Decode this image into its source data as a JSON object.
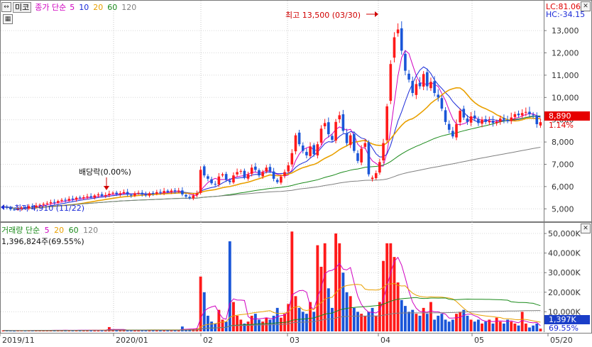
{
  "price_header": {
    "scroll_icon": "left-right-arrow-icon",
    "name_label": "미코",
    "ma_prefix": "종가 단순",
    "ma_periods": [
      {
        "label": "5",
        "color": "#d000c0"
      },
      {
        "label": "10",
        "color": "#1a2ad8"
      },
      {
        "label": "20",
        "color": "#e9a000"
      },
      {
        "label": "60",
        "color": "#1a8a1a"
      },
      {
        "label": "120",
        "color": "#808080"
      }
    ],
    "grid_icon": "table-grid-icon"
  },
  "volume_header": {
    "ma_prefix": "거래량 단순",
    "ma_periods": [
      {
        "label": "5",
        "color": "#d000c0"
      },
      {
        "label": "20",
        "color": "#e9a000"
      },
      {
        "label": "60",
        "color": "#1a8a1a"
      },
      {
        "label": "120",
        "color": "#808080"
      }
    ],
    "current_volume": "1,396,824주(69.55%)"
  },
  "readouts": {
    "lc": "LC:81.06",
    "hc": "HC:-34.15",
    "price_tag": "8,890",
    "change_tag": "1.14%",
    "volume_tag": "1,397K",
    "volume_pct_tag": "69.55%"
  },
  "annotations": {
    "high": "최고 13,500 (03/30)",
    "low": "최저 4,910 (11/22)",
    "dividend": "배당락(0.00%)"
  },
  "close_icon": "close-x-icon",
  "chart_data": [
    {
      "type": "candlestick",
      "title": "미코",
      "y_ticks": [
        "13,000",
        "12,000",
        "11,000",
        "10,000",
        "9,000",
        "8,000",
        "7,000",
        "6,000",
        "5,000"
      ],
      "x_ticks": [
        "2019/11",
        "2020/01",
        "02",
        "03",
        "04",
        "05",
        "05/20"
      ],
      "ylim": [
        4500,
        13800
      ],
      "up_color": "#ff1a1a",
      "down_color": "#1a56d8",
      "last_price": 8890,
      "high": 13500,
      "low": 4910,
      "series": [
        {
          "name": "5",
          "color": "#d000c0"
        },
        {
          "name": "10",
          "color": "#1a2ad8"
        },
        {
          "name": "20",
          "color": "#e9a000"
        },
        {
          "name": "60",
          "color": "#1a8a1a"
        },
        {
          "name": "120",
          "color": "#808080"
        }
      ],
      "closes": [
        5100,
        5050,
        4980,
        4950,
        5000,
        5060,
        5020,
        5120,
        5080,
        5150,
        5180,
        5220,
        5250,
        5300,
        5280,
        5350,
        5400,
        5380,
        5450,
        5420,
        5500,
        5480,
        5520,
        5560,
        5510,
        5600,
        5650,
        5580,
        5620,
        5680,
        5720,
        5660,
        5700,
        5750,
        5640,
        5600,
        5700,
        5720,
        5650,
        5600,
        5700,
        5680,
        5750,
        5720,
        5800,
        5760,
        5820,
        5780,
        5820,
        5650,
        5550,
        5480,
        5600,
        5700,
        6750,
        6500,
        6350,
        6150,
        6100,
        6450,
        6550,
        6300,
        6200,
        6500,
        6650,
        6700,
        6400,
        6550,
        6850,
        6750,
        6500,
        6650,
        6850,
        6700,
        6350,
        6200,
        6450,
        6650,
        6950,
        7500,
        8300,
        7900,
        7600,
        7400,
        7800,
        7450,
        7900,
        8600,
        8850,
        8350,
        8100,
        8900,
        9200,
        8500,
        7950,
        8300,
        7600,
        7150,
        7700,
        7950,
        6550,
        6400,
        6600,
        7100,
        7950,
        9600,
        11500,
        12700,
        13050,
        12100,
        11200,
        10800,
        10200,
        10600,
        10500,
        11050,
        10500,
        10700,
        10200,
        10000,
        9500,
        8900,
        8550,
        8250,
        8800,
        9400,
        9100,
        8900,
        9150,
        9050,
        8850,
        9000,
        8900,
        8950,
        8850,
        8900,
        9050,
        9000,
        8950,
        9100,
        9250,
        9200,
        9300,
        9350,
        9250,
        9200,
        8800,
        8890
      ],
      "volume": {
        "type": "bar",
        "y_ticks": [
          "50,000K",
          "40,000K",
          "30,000K",
          "20,000K",
          "10,000K"
        ],
        "ylim": [
          0,
          54000
        ],
        "values": [
          500,
          400,
          350,
          300,
          380,
          420,
          350,
          500,
          450,
          520,
          600,
          550,
          480,
          650,
          700,
          600,
          550,
          500,
          620,
          580,
          700,
          650,
          600,
          550,
          700,
          750,
          680,
          600,
          650,
          2200,
          700,
          750,
          650,
          600,
          700,
          680,
          720,
          650,
          700,
          600,
          800,
          750,
          700,
          650,
          720,
          680,
          700,
          650,
          600,
          2500,
          900,
          1100,
          1200,
          1500,
          28000,
          20000,
          8000,
          5000,
          4000,
          11000,
          6000,
          5000,
          46000,
          15000,
          8000,
          6000,
          4000,
          5000,
          8000,
          9000,
          6000,
          5000,
          7000,
          6000,
          8000,
          12000,
          7000,
          9000,
          14000,
          51000,
          18000,
          12000,
          10000,
          9000,
          15000,
          10000,
          44000,
          33000,
          45000,
          22000,
          12000,
          50000,
          45000,
          30000,
          20000,
          18000,
          12000,
          10000,
          9000,
          8000,
          10000,
          12000,
          8000,
          15000,
          36000,
          45000,
          45000,
          38000,
          25000,
          16000,
          13000,
          10000,
          11000,
          9000,
          8000,
          12000,
          9000,
          15000,
          6000,
          8000,
          9000,
          6000,
          5000,
          6000,
          9000,
          10000,
          11000,
          8000,
          6000,
          5000,
          6000,
          4000,
          5000,
          6000,
          4000,
          7000,
          5000,
          4000,
          6000,
          5000,
          4000,
          3000,
          10000,
          4000,
          2000,
          3000,
          4000,
          1400
        ]
      }
    }
  ]
}
